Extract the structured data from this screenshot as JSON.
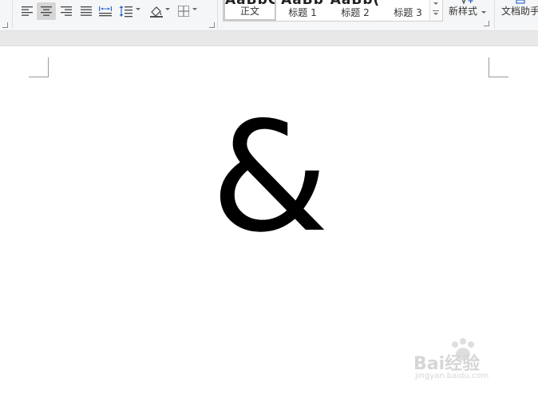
{
  "ribbon": {
    "paragraph": {
      "align_left_icon": "align-left-icon",
      "align_center_icon": "align-center-icon",
      "align_right_icon": "align-right-icon",
      "justify_icon": "justify-icon",
      "distribute_icon": "distribute-icon",
      "line_spacing_icon": "line-spacing-icon",
      "shading_icon": "shading-icon",
      "borders_icon": "borders-icon",
      "active": "align_center"
    },
    "styles": {
      "items": [
        {
          "preview": "AaBbCcDd",
          "label": "正文"
        },
        {
          "preview": "AaBb",
          "label": "标题 1"
        },
        {
          "preview": "AaBb(",
          "label": "标题 2"
        },
        {
          "preview": "",
          "label": "标题 3"
        }
      ],
      "new_style_label": "新样式",
      "doc_assistant_label": "文档助手"
    }
  },
  "document": {
    "content": "&"
  },
  "watermark": {
    "text": "Bai经验",
    "sub": "jingyan.baidu.com"
  },
  "colors": {
    "ribbon_bg": "#f5f6f7",
    "active_button_bg": "#d6d6d6",
    "page_bg": "#ffffff"
  }
}
